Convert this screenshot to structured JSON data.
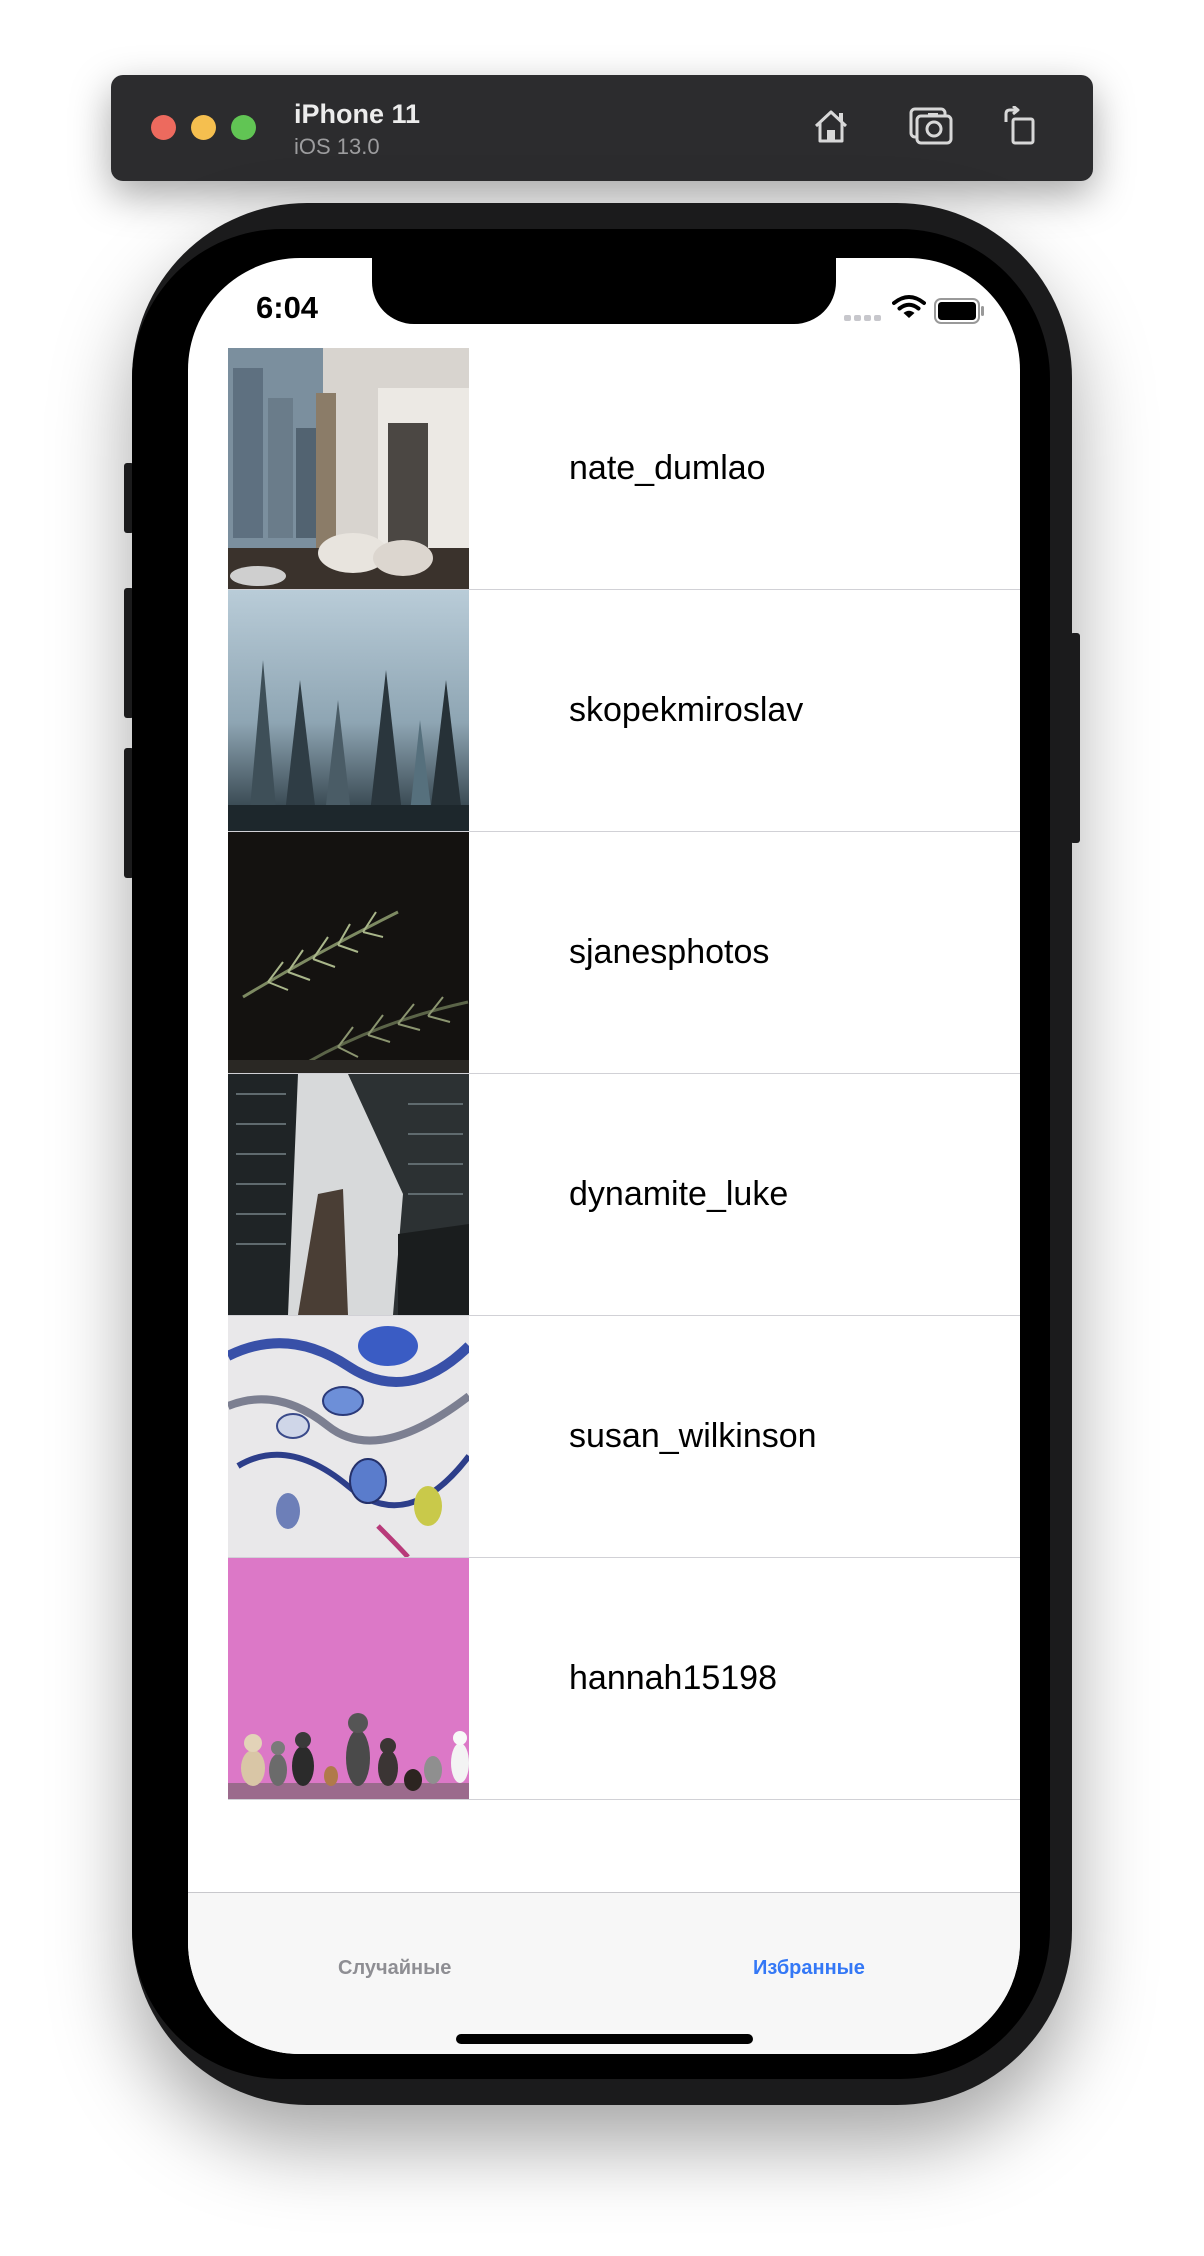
{
  "simulator": {
    "device_name": "iPhone 11",
    "os_version": "iOS 13.0",
    "buttons": [
      {
        "name": "home-icon"
      },
      {
        "name": "screenshot-icon"
      },
      {
        "name": "rotate-icon"
      }
    ]
  },
  "status_bar": {
    "time": "6:04",
    "signal_icon": "cellular-signal-icon",
    "wifi_icon": "wifi-icon",
    "battery_icon": "battery-icon"
  },
  "list": {
    "items": [
      {
        "username": "nate_dumlao",
        "photo": "city apartment interior with book stack"
      },
      {
        "username": "skopekmiroslav",
        "photo": "misty pine forest"
      },
      {
        "username": "sjanesphotos",
        "photo": "pine branch on dark background"
      },
      {
        "username": "dynamite_luke",
        "photo": "skyscrapers looking up"
      },
      {
        "username": "susan_wilkinson",
        "photo": "abstract blue fluid art"
      },
      {
        "username": "hannah15198",
        "photo": "dogs against pink wall"
      }
    ]
  },
  "tab_bar": {
    "tabs": [
      {
        "label": "Случайные",
        "selected": false
      },
      {
        "label": "Избранные",
        "selected": true
      }
    ],
    "selected_color": "#3478f6",
    "unselected_color": "#8e8e93"
  }
}
